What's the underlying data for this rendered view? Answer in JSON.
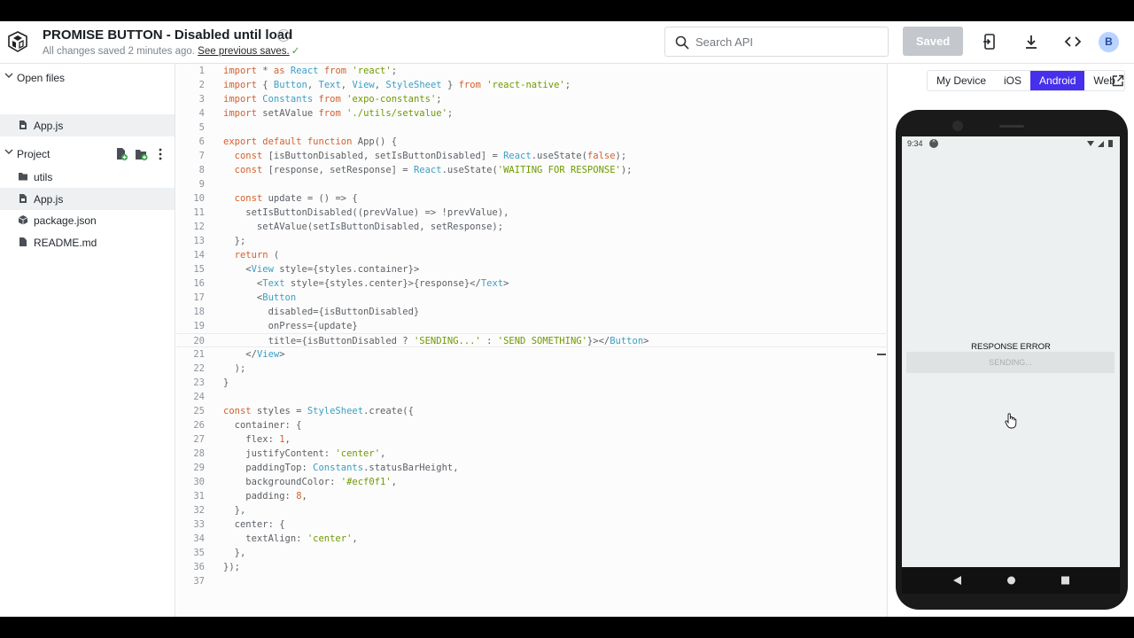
{
  "header": {
    "title": "PROMISE BUTTON - Disabled until load",
    "status_text": "All changes saved 2 minutes ago.",
    "status_link": "See previous saves.",
    "search_placeholder": "Search API",
    "saved_label": "Saved",
    "avatar_initial": "B",
    "icons": [
      "snack-logo-icon",
      "info-icon",
      "search-icon",
      "device-connect-icon",
      "download-icon",
      "embed-code-icon"
    ]
  },
  "sidebar": {
    "open_files": {
      "label": "Open files",
      "items": [
        {
          "label": "App.js",
          "icon": "file-icon"
        }
      ]
    },
    "project": {
      "label": "Project",
      "items": [
        {
          "label": "utils",
          "icon": "folder-icon"
        },
        {
          "label": "App.js",
          "icon": "file-icon"
        },
        {
          "label": "package.json",
          "icon": "package-icon"
        },
        {
          "label": "README.md",
          "icon": "document-icon"
        }
      ]
    }
  },
  "editor": {
    "current_line": 20,
    "lines": [
      "import * as React from 'react';",
      "import { Button, Text, View, StyleSheet } from 'react-native';",
      "import Constants from 'expo-constants';",
      "import setAValue from './utils/setvalue';",
      "",
      "export default function App() {",
      "  const [isButtonDisabled, setIsButtonDisabled] = React.useState(false);",
      "  const [response, setResponse] = React.useState('WAITING FOR RESPONSE');",
      "",
      "  const update = () => {",
      "    setIsButtonDisabled((prevValue) => !prevValue),",
      "      setAValue(setIsButtonDisabled, setResponse);",
      "  };",
      "  return (",
      "    <View style={styles.container}>",
      "      <Text style={styles.center}>{response}</Text>",
      "      <Button",
      "        disabled={isButtonDisabled}",
      "        onPress={update}",
      "        title={isButtonDisabled ? 'SENDING...' : 'SEND SOMETHING'}></Button>",
      "    </View>",
      "  );",
      "}",
      "",
      "const styles = StyleSheet.create({",
      "  container: {",
      "    flex: 1,",
      "    justifyContent: 'center',",
      "    paddingTop: Constants.statusBarHeight,",
      "    backgroundColor: '#ecf0f1',",
      "    padding: 8,",
      "  },",
      "  center: {",
      "    textAlign: 'center',",
      "  },",
      "});",
      ""
    ]
  },
  "preview": {
    "tabs": [
      {
        "label": "My Device",
        "active": false
      },
      {
        "label": "iOS",
        "active": false
      },
      {
        "label": "Android",
        "active": true
      },
      {
        "label": "Web",
        "active": false
      }
    ],
    "phone": {
      "time": "9:34",
      "response_text": "RESPONSE ERROR",
      "button_label": "SENDING..."
    }
  },
  "colors": {
    "accent": "#4630eb",
    "keyword": "#d4602e",
    "string": "#6f9a00",
    "type": "#3b9fc6",
    "phone_screen": "#ecf0f1"
  }
}
